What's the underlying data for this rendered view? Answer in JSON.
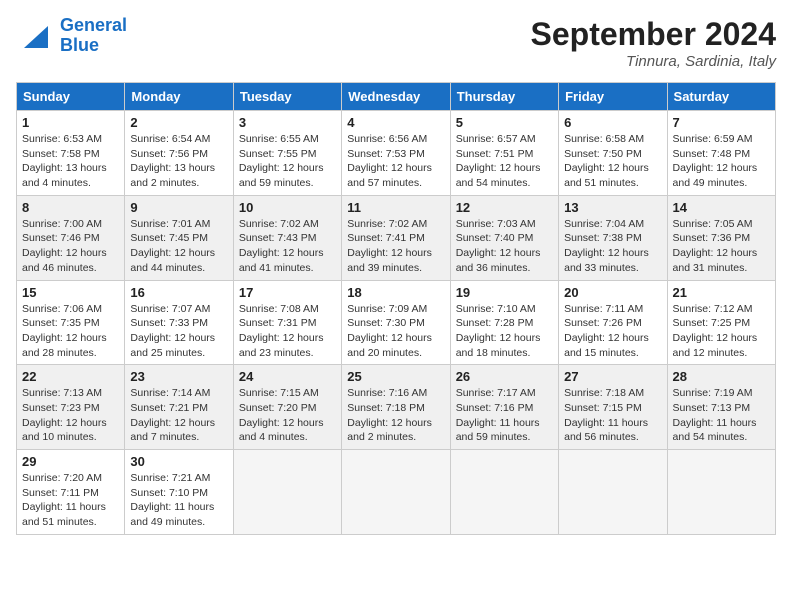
{
  "logo": {
    "line1": "General",
    "line2": "Blue"
  },
  "title": "September 2024",
  "location": "Tinnura, Sardinia, Italy",
  "headers": [
    "Sunday",
    "Monday",
    "Tuesday",
    "Wednesday",
    "Thursday",
    "Friday",
    "Saturday"
  ],
  "weeks": [
    [
      {
        "day": "1",
        "sunrise": "6:53 AM",
        "sunset": "7:58 PM",
        "daylight": "13 hours and 4 minutes."
      },
      {
        "day": "2",
        "sunrise": "6:54 AM",
        "sunset": "7:56 PM",
        "daylight": "13 hours and 2 minutes."
      },
      {
        "day": "3",
        "sunrise": "6:55 AM",
        "sunset": "7:55 PM",
        "daylight": "12 hours and 59 minutes."
      },
      {
        "day": "4",
        "sunrise": "6:56 AM",
        "sunset": "7:53 PM",
        "daylight": "12 hours and 57 minutes."
      },
      {
        "day": "5",
        "sunrise": "6:57 AM",
        "sunset": "7:51 PM",
        "daylight": "12 hours and 54 minutes."
      },
      {
        "day": "6",
        "sunrise": "6:58 AM",
        "sunset": "7:50 PM",
        "daylight": "12 hours and 51 minutes."
      },
      {
        "day": "7",
        "sunrise": "6:59 AM",
        "sunset": "7:48 PM",
        "daylight": "12 hours and 49 minutes."
      }
    ],
    [
      {
        "day": "8",
        "sunrise": "7:00 AM",
        "sunset": "7:46 PM",
        "daylight": "12 hours and 46 minutes."
      },
      {
        "day": "9",
        "sunrise": "7:01 AM",
        "sunset": "7:45 PM",
        "daylight": "12 hours and 44 minutes."
      },
      {
        "day": "10",
        "sunrise": "7:02 AM",
        "sunset": "7:43 PM",
        "daylight": "12 hours and 41 minutes."
      },
      {
        "day": "11",
        "sunrise": "7:02 AM",
        "sunset": "7:41 PM",
        "daylight": "12 hours and 39 minutes."
      },
      {
        "day": "12",
        "sunrise": "7:03 AM",
        "sunset": "7:40 PM",
        "daylight": "12 hours and 36 minutes."
      },
      {
        "day": "13",
        "sunrise": "7:04 AM",
        "sunset": "7:38 PM",
        "daylight": "12 hours and 33 minutes."
      },
      {
        "day": "14",
        "sunrise": "7:05 AM",
        "sunset": "7:36 PM",
        "daylight": "12 hours and 31 minutes."
      }
    ],
    [
      {
        "day": "15",
        "sunrise": "7:06 AM",
        "sunset": "7:35 PM",
        "daylight": "12 hours and 28 minutes."
      },
      {
        "day": "16",
        "sunrise": "7:07 AM",
        "sunset": "7:33 PM",
        "daylight": "12 hours and 25 minutes."
      },
      {
        "day": "17",
        "sunrise": "7:08 AM",
        "sunset": "7:31 PM",
        "daylight": "12 hours and 23 minutes."
      },
      {
        "day": "18",
        "sunrise": "7:09 AM",
        "sunset": "7:30 PM",
        "daylight": "12 hours and 20 minutes."
      },
      {
        "day": "19",
        "sunrise": "7:10 AM",
        "sunset": "7:28 PM",
        "daylight": "12 hours and 18 minutes."
      },
      {
        "day": "20",
        "sunrise": "7:11 AM",
        "sunset": "7:26 PM",
        "daylight": "12 hours and 15 minutes."
      },
      {
        "day": "21",
        "sunrise": "7:12 AM",
        "sunset": "7:25 PM",
        "daylight": "12 hours and 12 minutes."
      }
    ],
    [
      {
        "day": "22",
        "sunrise": "7:13 AM",
        "sunset": "7:23 PM",
        "daylight": "12 hours and 10 minutes."
      },
      {
        "day": "23",
        "sunrise": "7:14 AM",
        "sunset": "7:21 PM",
        "daylight": "12 hours and 7 minutes."
      },
      {
        "day": "24",
        "sunrise": "7:15 AM",
        "sunset": "7:20 PM",
        "daylight": "12 hours and 4 minutes."
      },
      {
        "day": "25",
        "sunrise": "7:16 AM",
        "sunset": "7:18 PM",
        "daylight": "12 hours and 2 minutes."
      },
      {
        "day": "26",
        "sunrise": "7:17 AM",
        "sunset": "7:16 PM",
        "daylight": "11 hours and 59 minutes."
      },
      {
        "day": "27",
        "sunrise": "7:18 AM",
        "sunset": "7:15 PM",
        "daylight": "11 hours and 56 minutes."
      },
      {
        "day": "28",
        "sunrise": "7:19 AM",
        "sunset": "7:13 PM",
        "daylight": "11 hours and 54 minutes."
      }
    ],
    [
      {
        "day": "29",
        "sunrise": "7:20 AM",
        "sunset": "7:11 PM",
        "daylight": "11 hours and 51 minutes."
      },
      {
        "day": "30",
        "sunrise": "7:21 AM",
        "sunset": "7:10 PM",
        "daylight": "11 hours and 49 minutes."
      },
      null,
      null,
      null,
      null,
      null
    ]
  ],
  "shaded_rows": [
    1,
    3
  ]
}
